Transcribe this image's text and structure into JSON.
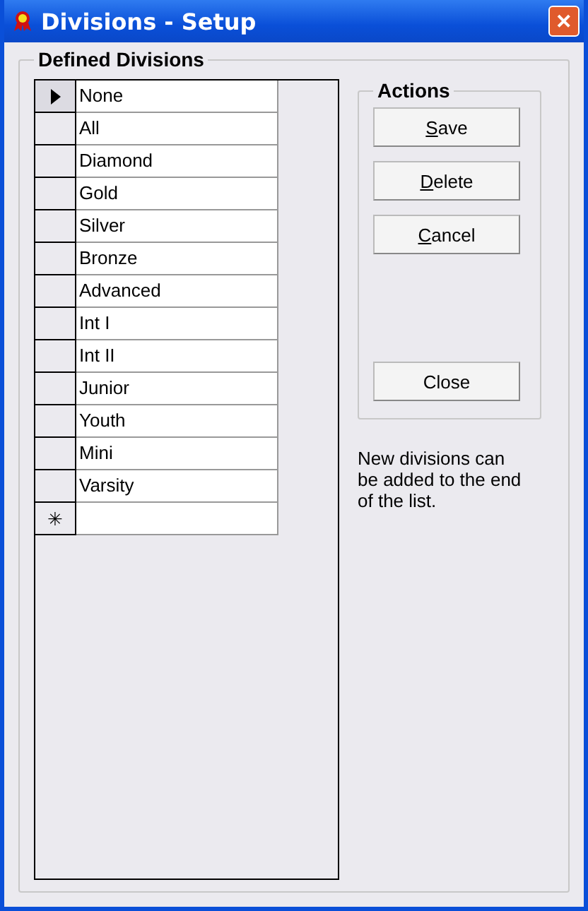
{
  "window": {
    "title": "Divisions - Setup",
    "close_glyph": "✕"
  },
  "divisions_group": {
    "legend": "Defined Divisions",
    "rows": [
      {
        "name": "None",
        "selected": true
      },
      {
        "name": "All",
        "selected": false
      },
      {
        "name": "Diamond",
        "selected": false
      },
      {
        "name": "Gold",
        "selected": false
      },
      {
        "name": "Silver",
        "selected": false
      },
      {
        "name": "Bronze",
        "selected": false
      },
      {
        "name": "Advanced",
        "selected": false
      },
      {
        "name": "Int I",
        "selected": false
      },
      {
        "name": "Int II",
        "selected": false
      },
      {
        "name": "Junior",
        "selected": false
      },
      {
        "name": "Youth",
        "selected": false
      },
      {
        "name": "Mini",
        "selected": false
      },
      {
        "name": "Varsity",
        "selected": false
      }
    ],
    "new_row_marker": "✳"
  },
  "actions_group": {
    "legend": "Actions",
    "buttons": [
      {
        "accel": "S",
        "rest": "ave"
      },
      {
        "accel": "D",
        "rest": "elete"
      },
      {
        "accel": "C",
        "rest": "ancel"
      },
      {
        "rest": "Close"
      }
    ]
  },
  "hint": "New divisions can be added to the end of the list."
}
